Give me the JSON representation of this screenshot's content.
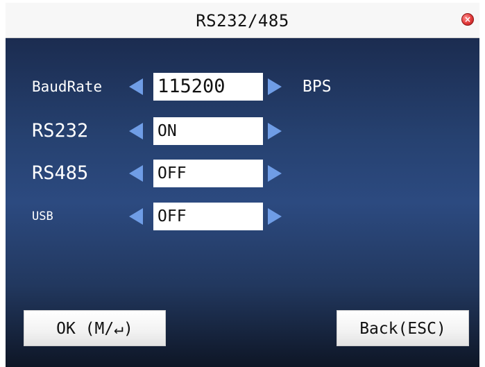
{
  "window": {
    "title": "RS232/485",
    "close_icon": "close-icon"
  },
  "settings": [
    {
      "label": "BaudRate",
      "value": "115200",
      "unit": "BPS"
    },
    {
      "label": "RS232",
      "value": "ON"
    },
    {
      "label": "RS485",
      "value": "OFF"
    },
    {
      "label": "USB",
      "value": "OFF"
    }
  ],
  "buttons": {
    "ok_label": "OK (M/↵)",
    "back_label": "Back(ESC)"
  },
  "colors": {
    "panel_top": "#1b2c50",
    "panel_mid": "#2c4a80",
    "panel_bottom": "#0e1626",
    "arrow": "#6f9de6",
    "close": "#e23a3a"
  }
}
